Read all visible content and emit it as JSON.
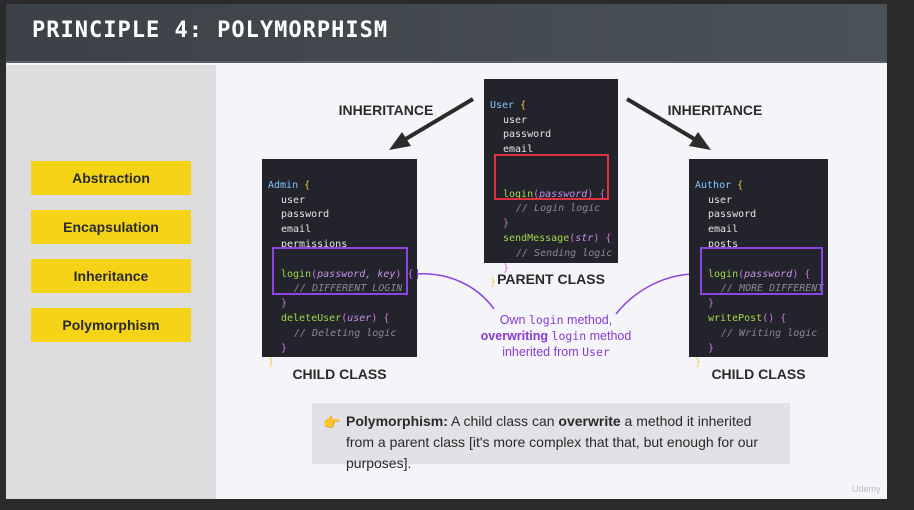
{
  "title": "PRINCIPLE 4: POLYMORPHISM",
  "principles": [
    "Abstraction",
    "Encapsulation",
    "Inheritance",
    "Polymorphism"
  ],
  "inheritance_label_left": "INHERITANCE",
  "inheritance_label_right": "INHERITANCE",
  "parent_label": "PARENT CLASS",
  "child_label_left": "CHILD CLASS",
  "child_label_right": "CHILD CLASS",
  "user_class": {
    "name": "User",
    "open": "{",
    "props": [
      "user",
      "password",
      "email"
    ],
    "method1": "login",
    "method1_open": "(",
    "method1_params": "password",
    "method1_close": ") {",
    "method1_comment": "// Login logic",
    "close_brace": "}",
    "method2": "sendMessage",
    "method2_open": "(",
    "method2_params": "str",
    "method2_close": ") {",
    "method2_comment": "// Sending logic",
    "end": "}"
  },
  "admin_class": {
    "name": "Admin",
    "open": "{",
    "props": [
      "user",
      "password",
      "email",
      "permissions"
    ],
    "method1": "login",
    "method1_open": "(",
    "method1_params": "password, key",
    "method1_close": ") {",
    "method1_comment": "// DIFFERENT LOGIN",
    "close_brace": "}",
    "method2": "deleteUser",
    "method2_open": "(",
    "method2_params": "user",
    "method2_close": ") {",
    "method2_comment": "// Deleting logic",
    "end": "}"
  },
  "author_class": {
    "name": "Author",
    "open": "{",
    "props": [
      "user",
      "password",
      "email",
      "posts"
    ],
    "method1": "login",
    "method1_open": "(",
    "method1_params": "password",
    "method1_close": ") {",
    "method1_comment": "// MORE DIFFERENT",
    "close_brace": "}",
    "method2": "writePost",
    "method2_open": "() {",
    "method2_comment": "// Writing logic",
    "end": "}"
  },
  "annotation": {
    "line1_a": "Own ",
    "line1_code": "login",
    "line1_b": " method,",
    "line2_bold": "overwriting",
    "line2_a": " ",
    "line2_code": "login",
    "line2_b": " method",
    "line3_a": "inherited from ",
    "line3_code": "User"
  },
  "note": {
    "icon": "👉",
    "bold1": "Polymorphism:",
    "text1": " A child class can ",
    "bold2": "overwrite",
    "text2": " a method it inherited from a parent class [it's more complex that that, but enough for our purposes]."
  },
  "watermark": "Udemy",
  "colors": {
    "accent_yellow": "#f5d418",
    "code_bg": "#23232b",
    "parent_highlight": "#e0323f",
    "child_highlight": "#8b45e0",
    "annotation_purple": "#8a3bd1"
  }
}
